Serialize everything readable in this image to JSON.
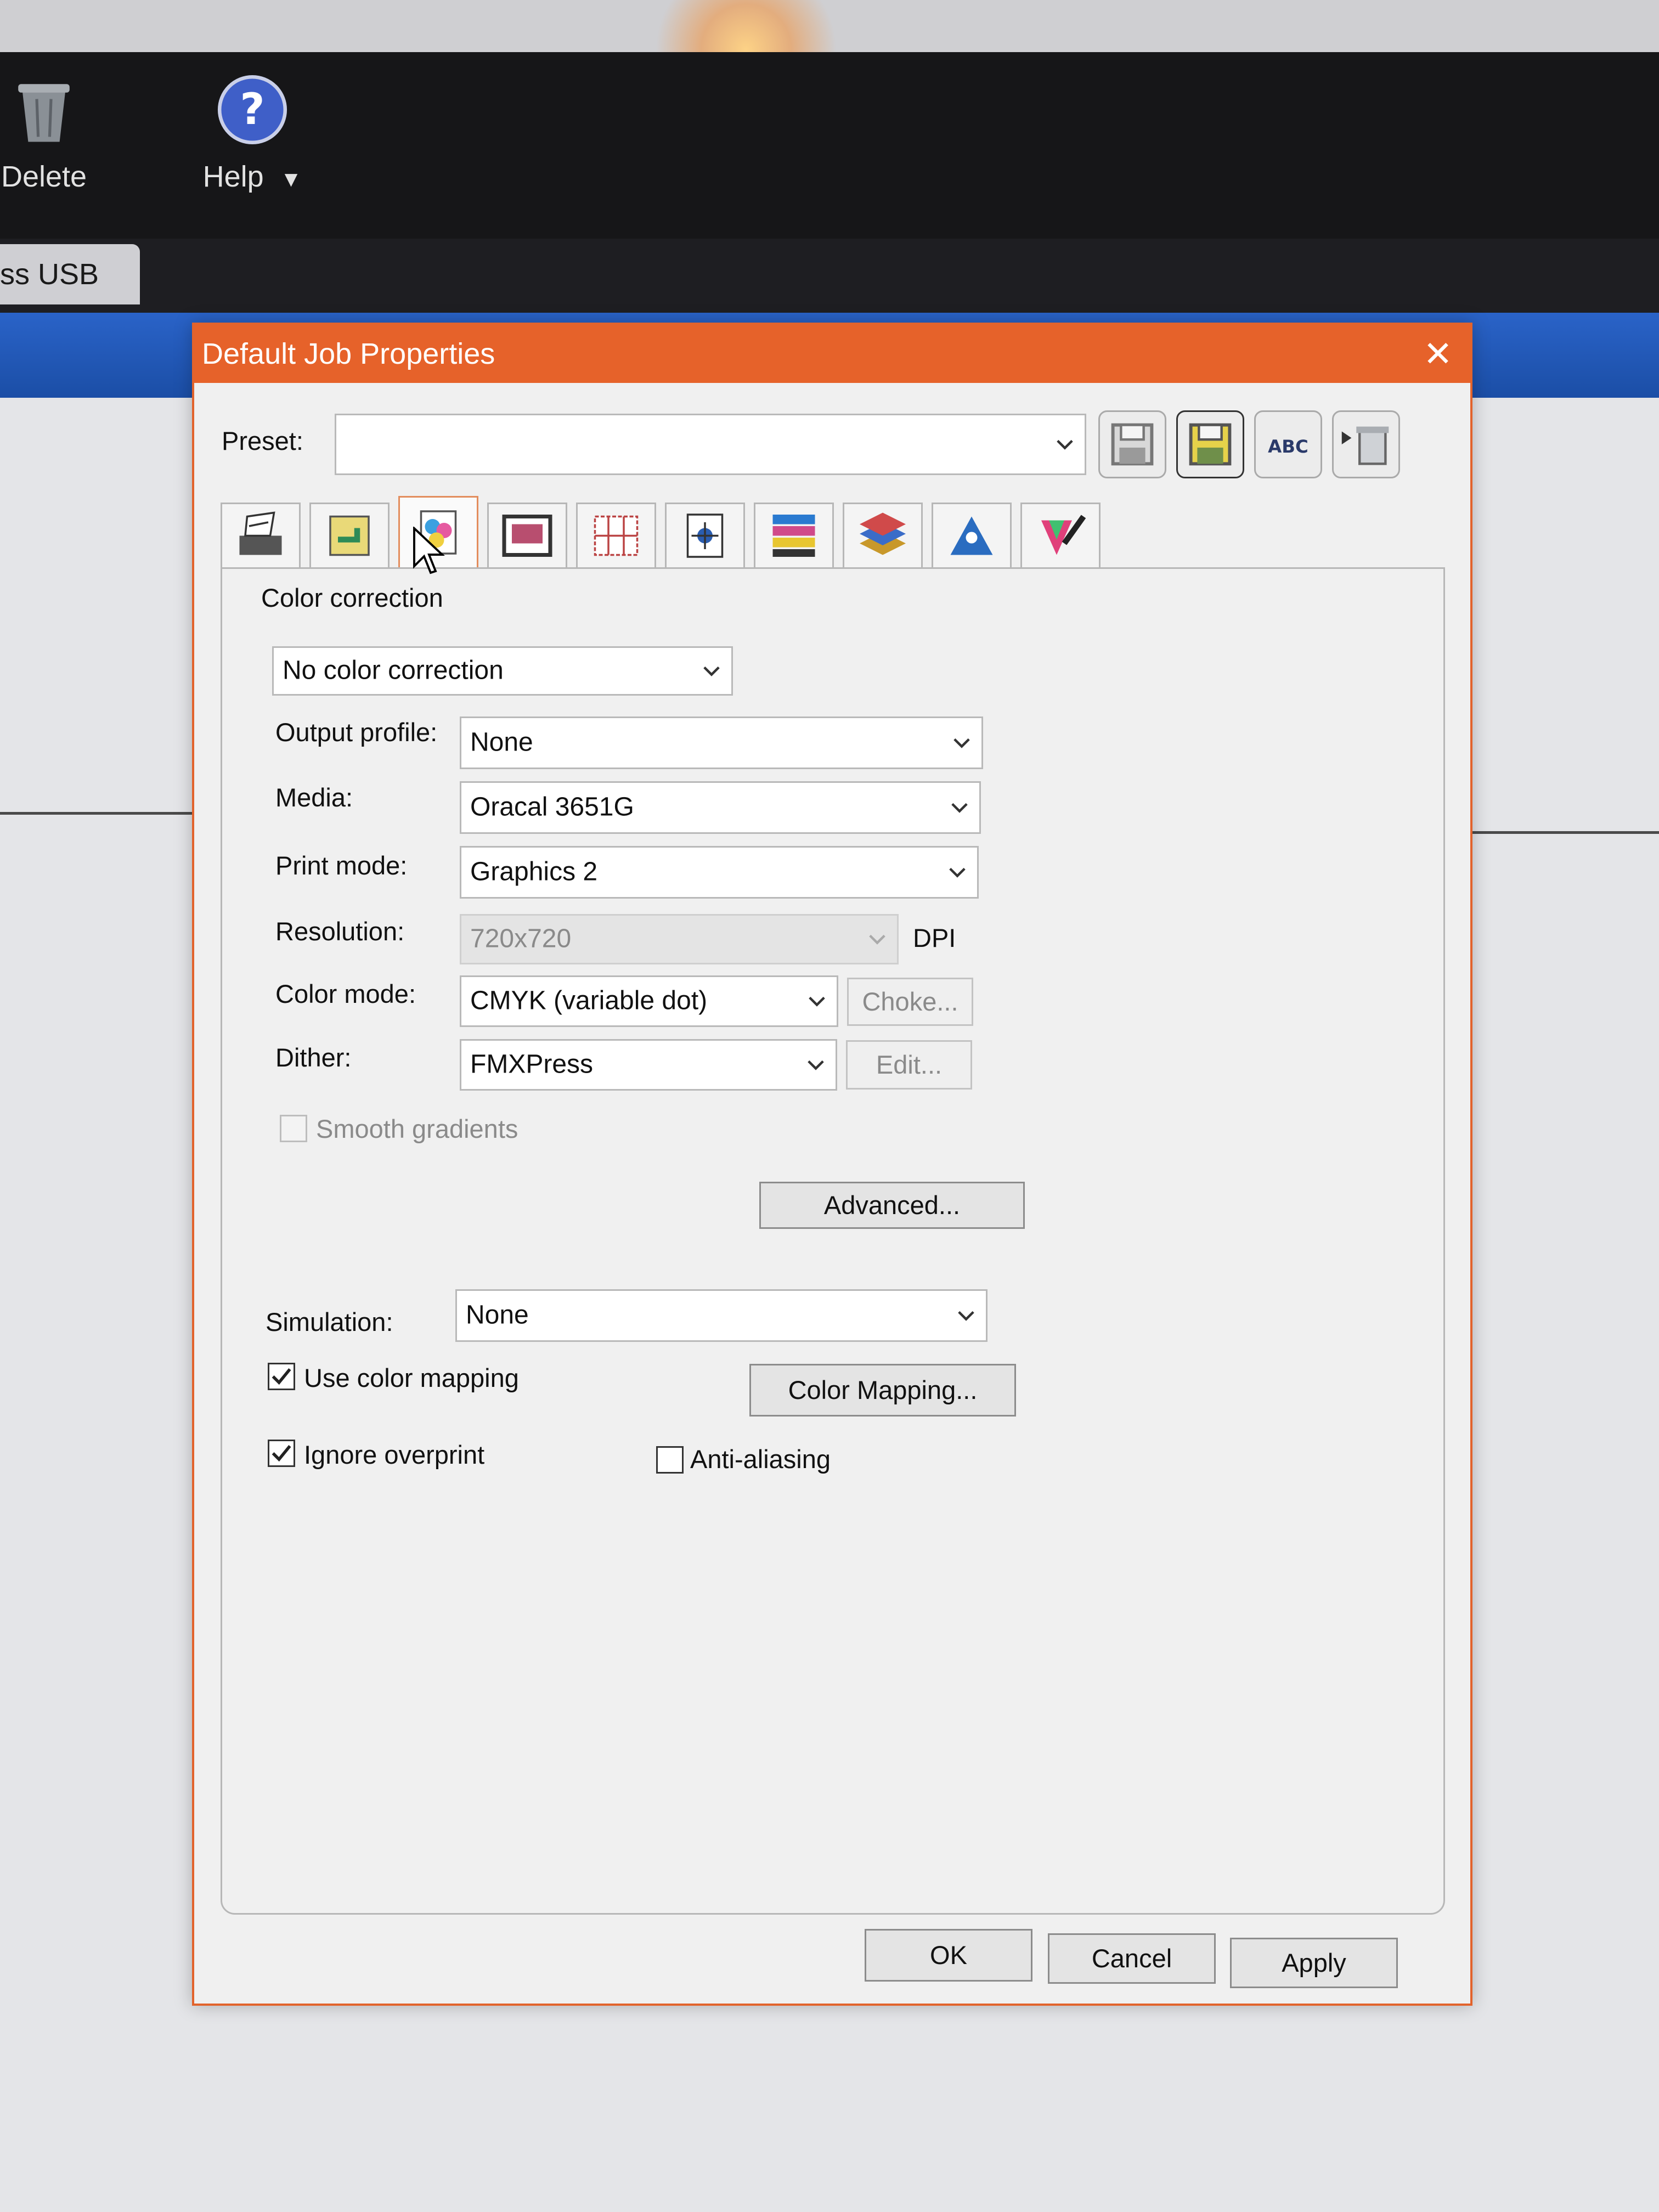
{
  "app": {
    "toolbar": [
      {
        "label": "Delete",
        "icon": "trash-icon"
      },
      {
        "label": "Help",
        "icon": "help-icon"
      }
    ],
    "help_arrow": "▼",
    "tab_label": "ess USB"
  },
  "dialog": {
    "title": "Default Job Properties",
    "close_glyph": "✕",
    "preset": {
      "label": "Preset:",
      "value": ""
    },
    "preset_buttons": [
      "save-icon",
      "save-as-icon",
      "rename-icon",
      "delete-preset-icon"
    ],
    "rename_text": "ABC",
    "tabs": [
      "general-tab-icon",
      "transform-tab-icon",
      "color-tab-icon",
      "printer-tab-icon",
      "tiling-tab-icon",
      "marks-tab-icon",
      "color-bars-tab-icon",
      "layers-tab-icon",
      "cut-tab-icon",
      "color-picker-tab-icon"
    ],
    "active_tab_index": 2,
    "section_title": "Color correction",
    "color_correction": "No color correction",
    "fields": {
      "output_profile": {
        "label": "Output profile:",
        "value": "None"
      },
      "media": {
        "label": "Media:",
        "value": "Oracal 3651G"
      },
      "print_mode": {
        "label": "Print mode:",
        "value": "Graphics 2"
      },
      "resolution": {
        "label": "Resolution:",
        "value": "720x720",
        "unit": "DPI"
      },
      "color_mode": {
        "label": "Color mode:",
        "value": "CMYK (variable dot)",
        "button": "Choke..."
      },
      "dither": {
        "label": "Dither:",
        "value": "FMXPress",
        "button": "Edit..."
      }
    },
    "smooth_gradients": {
      "label": "Smooth gradients",
      "checked": false
    },
    "advanced_button": "Advanced...",
    "simulation": {
      "label": "Simulation:",
      "value": "None"
    },
    "use_color_mapping": {
      "label": "Use color mapping",
      "checked": true
    },
    "color_mapping_button": "Color Mapping...",
    "ignore_overprint": {
      "label": "Ignore overprint",
      "checked": true
    },
    "anti_aliasing": {
      "label": "Anti-aliasing",
      "checked": false
    },
    "footer": {
      "ok": "OK",
      "cancel": "Cancel",
      "apply": "Apply"
    }
  },
  "colors": {
    "titlebar": "#e6622a",
    "app_blue": "#2a63c8"
  }
}
